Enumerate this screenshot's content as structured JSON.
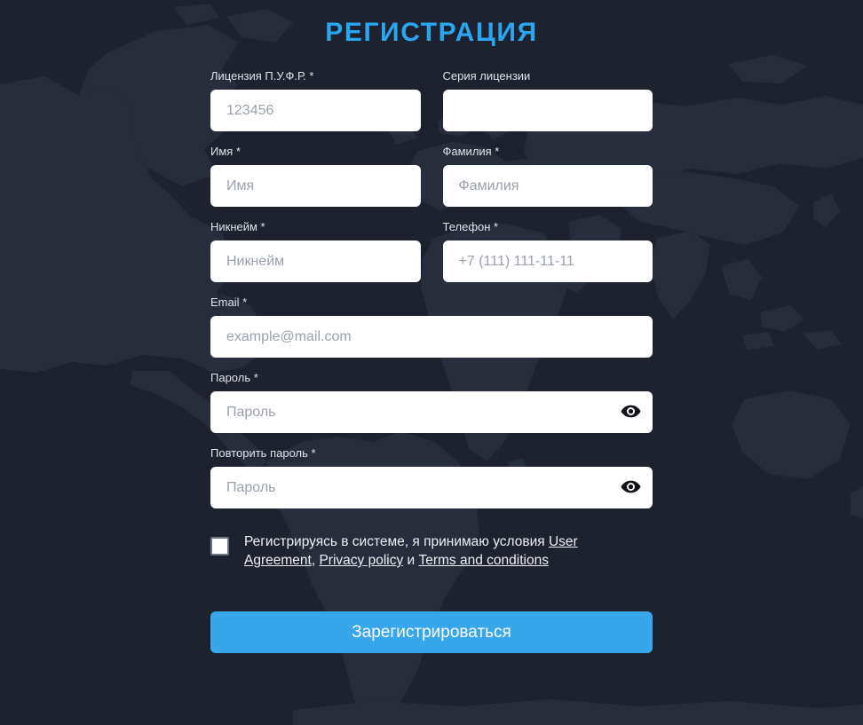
{
  "page": {
    "title": "РЕГИСТРАЦИЯ",
    "accent_color": "#2aa6f0",
    "background_color": "#1d222e",
    "landmass_color": "#272d3b",
    "button_color": "#38a6ea"
  },
  "fields": {
    "license": {
      "label": "Лицензия П.У.Ф.Р. *",
      "placeholder": "123456",
      "value": ""
    },
    "license_series": {
      "label": "Серия лицензии",
      "placeholder": "",
      "value": ""
    },
    "first_name": {
      "label": "Имя *",
      "placeholder": "Имя",
      "value": ""
    },
    "last_name": {
      "label": "Фамилия *",
      "placeholder": "Фамилия",
      "value": ""
    },
    "nickname": {
      "label": "Никнейм *",
      "placeholder": "Никнейм",
      "value": ""
    },
    "phone": {
      "label": "Телефон *",
      "placeholder": "+7 (111) 111-11-11",
      "value": ""
    },
    "email": {
      "label": "Email *",
      "placeholder": "example@mail.com",
      "value": ""
    },
    "password": {
      "label": "Пароль *",
      "placeholder": "Пароль",
      "value": "",
      "toggle_icon": "eye-icon"
    },
    "password_repeat": {
      "label": "Повторить пароль *",
      "placeholder": "Пароль",
      "value": "",
      "toggle_icon": "eye-icon"
    }
  },
  "agreement": {
    "checked": false,
    "text_before": "Регистрируясь в системе, я принимаю условия ",
    "link_user_agreement": "User Agreement",
    "separator_comma": ", ",
    "link_privacy_policy": "Privacy policy",
    "conjunction": " и ",
    "link_terms": "Terms and conditions"
  },
  "submit": {
    "label": "Зарегистрироваться"
  }
}
